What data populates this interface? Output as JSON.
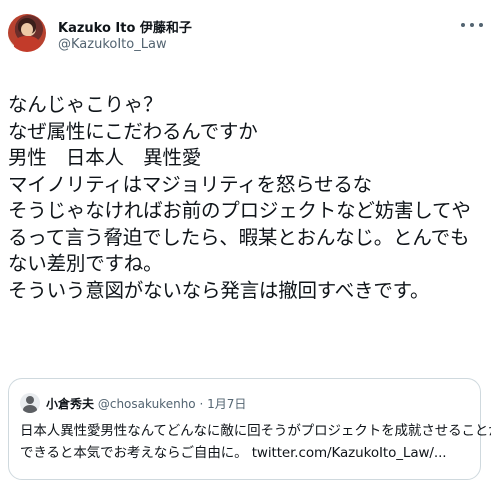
{
  "author": {
    "display_name": "Kazuko Ito 伊藤和子",
    "handle": "@KazukoIto_Law",
    "avatar_icon": "profile-photo"
  },
  "more_icon": "more-horizontal-icon",
  "tweet": {
    "lines": [
      "なんじゃこりゃ？",
      "なぜ属性にこだわるんですか",
      "男性　日本人　異性愛",
      "マイノリティはマジョリティを怒らせるな",
      "そうじゃなければお前のプロジェクトなど妨害してや",
      "るって言う脅迫でしたら、暇某とおんなじ。とんでも",
      "ない差別ですね。",
      "そういう意図がないなら発言は撤回すべきです。"
    ]
  },
  "quoted_tweet": {
    "display_name": "小倉秀夫",
    "handle": "@chosakukenho",
    "separator": "·",
    "date": "1月7日",
    "lines": [
      "日本人異性愛男性なんてどんなに敵に回そうがプロジェクトを成就させることが",
      "できると本気でお考えならご自由に。 twitter.com/KazukoIto_Law/..."
    ]
  },
  "colors": {
    "text": "#0f1419",
    "secondary_text": "#536471",
    "border": "#cfd9de"
  }
}
